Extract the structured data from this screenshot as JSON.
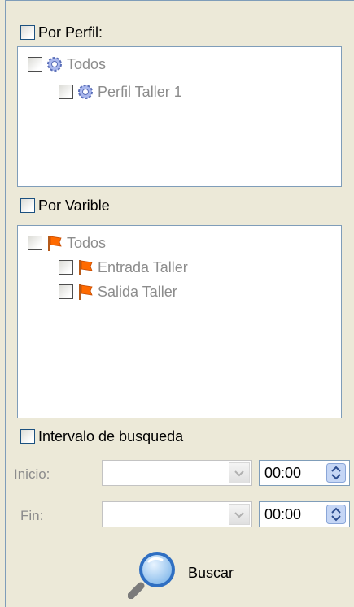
{
  "perfil": {
    "label": "Por Perfil:",
    "tree": [
      {
        "label": "Todos",
        "icon": "gear-icon"
      },
      {
        "label": "Perfil Taller 1",
        "icon": "gear-icon"
      }
    ]
  },
  "variable": {
    "label": "Por Varible",
    "tree": [
      {
        "label": "Todos",
        "icon": "flag-icon"
      },
      {
        "label": "Entrada Taller",
        "icon": "flag-icon"
      },
      {
        "label": "Salida Taller",
        "icon": "flag-icon"
      }
    ]
  },
  "intervalo": {
    "label": "Intervalo de busqueda",
    "inicio_label": "Inicio:",
    "fin_label": "Fin:",
    "inicio_time": "00:00",
    "fin_time": "00:00"
  },
  "search": {
    "label_first": "B",
    "label_rest": "uscar"
  },
  "colors": {
    "flag": "#ff6a00",
    "gear": "#7b8fd6",
    "border": "#7f9db9"
  }
}
